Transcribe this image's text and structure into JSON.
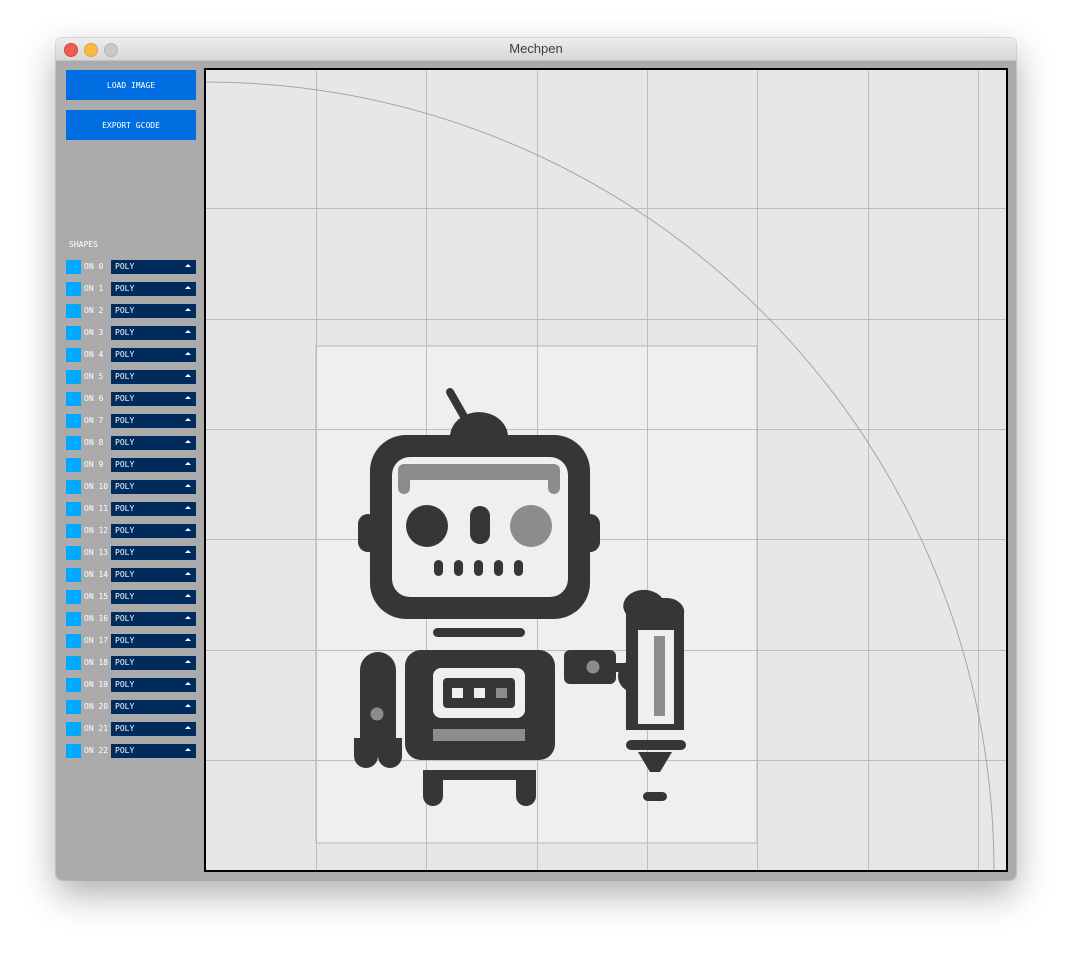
{
  "window": {
    "title": "Mechpen"
  },
  "toolbar": {
    "load_image_label": "LOAD IMAGE",
    "export_gcode_label": "EXPORT GCODE"
  },
  "shapes": {
    "heading": "SHAPES",
    "items": [
      {
        "label": "ON 0",
        "mode": "POLY"
      },
      {
        "label": "ON 1",
        "mode": "POLY"
      },
      {
        "label": "ON 2",
        "mode": "POLY"
      },
      {
        "label": "ON 3",
        "mode": "POLY"
      },
      {
        "label": "ON 4",
        "mode": "POLY"
      },
      {
        "label": "ON 5",
        "mode": "POLY"
      },
      {
        "label": "ON 6",
        "mode": "POLY"
      },
      {
        "label": "ON 7",
        "mode": "POLY"
      },
      {
        "label": "ON 8",
        "mode": "POLY"
      },
      {
        "label": "ON 9",
        "mode": "POLY"
      },
      {
        "label": "ON 10",
        "mode": "POLY"
      },
      {
        "label": "ON 11",
        "mode": "POLY"
      },
      {
        "label": "ON 12",
        "mode": "POLY"
      },
      {
        "label": "ON 13",
        "mode": "POLY"
      },
      {
        "label": "ON 14",
        "mode": "POLY"
      },
      {
        "label": "ON 15",
        "mode": "POLY"
      },
      {
        "label": "ON 16",
        "mode": "POLY"
      },
      {
        "label": "ON 17",
        "mode": "POLY"
      },
      {
        "label": "ON 18",
        "mode": "POLY"
      },
      {
        "label": "ON 19",
        "mode": "POLY"
      },
      {
        "label": "ON 20",
        "mode": "POLY"
      },
      {
        "label": "ON 21",
        "mode": "POLY"
      },
      {
        "label": "ON 22",
        "mode": "POLY"
      }
    ]
  },
  "colors": {
    "button_bg": "#006ee0",
    "toggle_on": "#00a8ff",
    "dropdown_bg": "#002c5d",
    "panel_bg": "#ababab",
    "canvas_bg": "#e7e7e7",
    "robot_dark": "#383536",
    "robot_gray": "#8c8c8c"
  }
}
